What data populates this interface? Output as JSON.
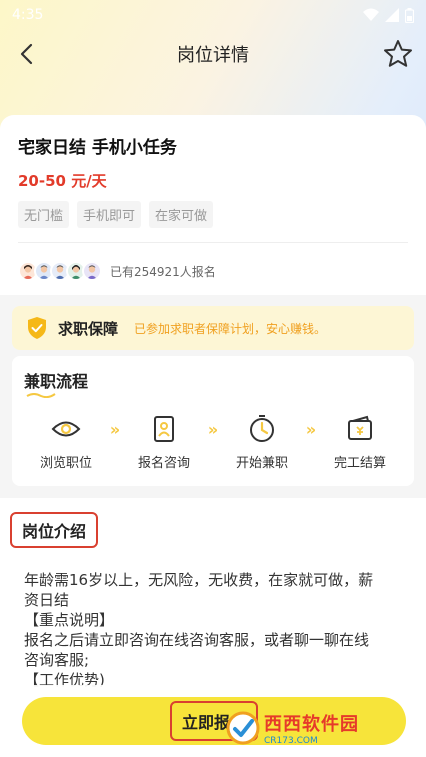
{
  "status_bar": {
    "time": "4:35"
  },
  "header": {
    "title": "岗位详情"
  },
  "job": {
    "title": "宅家日结 手机小任务",
    "salary": "20-50 元/天",
    "tags": [
      "无门槛",
      "手机即可",
      "在家可做"
    ],
    "signup_text": "已有254921人报名"
  },
  "guarantee": {
    "title": "求职保障",
    "desc": "已参加求职者保障计划，安心赚钱。"
  },
  "process": {
    "title": "兼职流程",
    "steps": [
      "浏览职位",
      "报名咨询",
      "开始兼职",
      "完工结算"
    ]
  },
  "intro": {
    "title": "岗位介绍",
    "lines": [
      "年龄需16岁以上，无风险，无收费，在家就可做，薪",
      "资日结",
      "【重点说明】",
      "报名之后请立即咨询在线咨询客服，或者聊一聊在线",
      "咨询客服;",
      "【工作优势)"
    ]
  },
  "bottom": {
    "apply_label": "立即报名"
  },
  "watermark": {
    "main": "西西软件园",
    "sub": "CR173.COM"
  },
  "colors": {
    "accent": "#f7e43a",
    "salary": "#e23b2a",
    "guarantee_text": "#f0a020",
    "highlight": "#d94030"
  }
}
